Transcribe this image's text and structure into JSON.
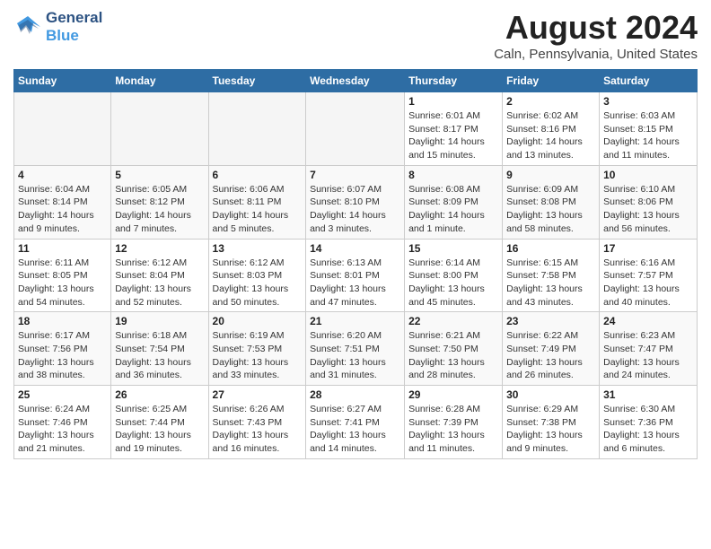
{
  "logo": {
    "line1": "General",
    "line2": "Blue"
  },
  "title": "August 2024",
  "location": "Caln, Pennsylvania, United States",
  "days_of_week": [
    "Sunday",
    "Monday",
    "Tuesday",
    "Wednesday",
    "Thursday",
    "Friday",
    "Saturday"
  ],
  "weeks": [
    [
      {
        "day": "",
        "empty": true
      },
      {
        "day": "",
        "empty": true
      },
      {
        "day": "",
        "empty": true
      },
      {
        "day": "",
        "empty": true
      },
      {
        "day": "1",
        "sunrise": "6:01 AM",
        "sunset": "8:17 PM",
        "daylight": "14 hours and 15 minutes."
      },
      {
        "day": "2",
        "sunrise": "6:02 AM",
        "sunset": "8:16 PM",
        "daylight": "14 hours and 13 minutes."
      },
      {
        "day": "3",
        "sunrise": "6:03 AM",
        "sunset": "8:15 PM",
        "daylight": "14 hours and 11 minutes."
      }
    ],
    [
      {
        "day": "4",
        "sunrise": "6:04 AM",
        "sunset": "8:14 PM",
        "daylight": "14 hours and 9 minutes."
      },
      {
        "day": "5",
        "sunrise": "6:05 AM",
        "sunset": "8:12 PM",
        "daylight": "14 hours and 7 minutes."
      },
      {
        "day": "6",
        "sunrise": "6:06 AM",
        "sunset": "8:11 PM",
        "daylight": "14 hours and 5 minutes."
      },
      {
        "day": "7",
        "sunrise": "6:07 AM",
        "sunset": "8:10 PM",
        "daylight": "14 hours and 3 minutes."
      },
      {
        "day": "8",
        "sunrise": "6:08 AM",
        "sunset": "8:09 PM",
        "daylight": "14 hours and 1 minute."
      },
      {
        "day": "9",
        "sunrise": "6:09 AM",
        "sunset": "8:08 PM",
        "daylight": "13 hours and 58 minutes."
      },
      {
        "day": "10",
        "sunrise": "6:10 AM",
        "sunset": "8:06 PM",
        "daylight": "13 hours and 56 minutes."
      }
    ],
    [
      {
        "day": "11",
        "sunrise": "6:11 AM",
        "sunset": "8:05 PM",
        "daylight": "13 hours and 54 minutes."
      },
      {
        "day": "12",
        "sunrise": "6:12 AM",
        "sunset": "8:04 PM",
        "daylight": "13 hours and 52 minutes."
      },
      {
        "day": "13",
        "sunrise": "6:12 AM",
        "sunset": "8:03 PM",
        "daylight": "13 hours and 50 minutes."
      },
      {
        "day": "14",
        "sunrise": "6:13 AM",
        "sunset": "8:01 PM",
        "daylight": "13 hours and 47 minutes."
      },
      {
        "day": "15",
        "sunrise": "6:14 AM",
        "sunset": "8:00 PM",
        "daylight": "13 hours and 45 minutes."
      },
      {
        "day": "16",
        "sunrise": "6:15 AM",
        "sunset": "7:58 PM",
        "daylight": "13 hours and 43 minutes."
      },
      {
        "day": "17",
        "sunrise": "6:16 AM",
        "sunset": "7:57 PM",
        "daylight": "13 hours and 40 minutes."
      }
    ],
    [
      {
        "day": "18",
        "sunrise": "6:17 AM",
        "sunset": "7:56 PM",
        "daylight": "13 hours and 38 minutes."
      },
      {
        "day": "19",
        "sunrise": "6:18 AM",
        "sunset": "7:54 PM",
        "daylight": "13 hours and 36 minutes."
      },
      {
        "day": "20",
        "sunrise": "6:19 AM",
        "sunset": "7:53 PM",
        "daylight": "13 hours and 33 minutes."
      },
      {
        "day": "21",
        "sunrise": "6:20 AM",
        "sunset": "7:51 PM",
        "daylight": "13 hours and 31 minutes."
      },
      {
        "day": "22",
        "sunrise": "6:21 AM",
        "sunset": "7:50 PM",
        "daylight": "13 hours and 28 minutes."
      },
      {
        "day": "23",
        "sunrise": "6:22 AM",
        "sunset": "7:49 PM",
        "daylight": "13 hours and 26 minutes."
      },
      {
        "day": "24",
        "sunrise": "6:23 AM",
        "sunset": "7:47 PM",
        "daylight": "13 hours and 24 minutes."
      }
    ],
    [
      {
        "day": "25",
        "sunrise": "6:24 AM",
        "sunset": "7:46 PM",
        "daylight": "13 hours and 21 minutes."
      },
      {
        "day": "26",
        "sunrise": "6:25 AM",
        "sunset": "7:44 PM",
        "daylight": "13 hours and 19 minutes."
      },
      {
        "day": "27",
        "sunrise": "6:26 AM",
        "sunset": "7:43 PM",
        "daylight": "13 hours and 16 minutes."
      },
      {
        "day": "28",
        "sunrise": "6:27 AM",
        "sunset": "7:41 PM",
        "daylight": "13 hours and 14 minutes."
      },
      {
        "day": "29",
        "sunrise": "6:28 AM",
        "sunset": "7:39 PM",
        "daylight": "13 hours and 11 minutes."
      },
      {
        "day": "30",
        "sunrise": "6:29 AM",
        "sunset": "7:38 PM",
        "daylight": "13 hours and 9 minutes."
      },
      {
        "day": "31",
        "sunrise": "6:30 AM",
        "sunset": "7:36 PM",
        "daylight": "13 hours and 6 minutes."
      }
    ]
  ]
}
